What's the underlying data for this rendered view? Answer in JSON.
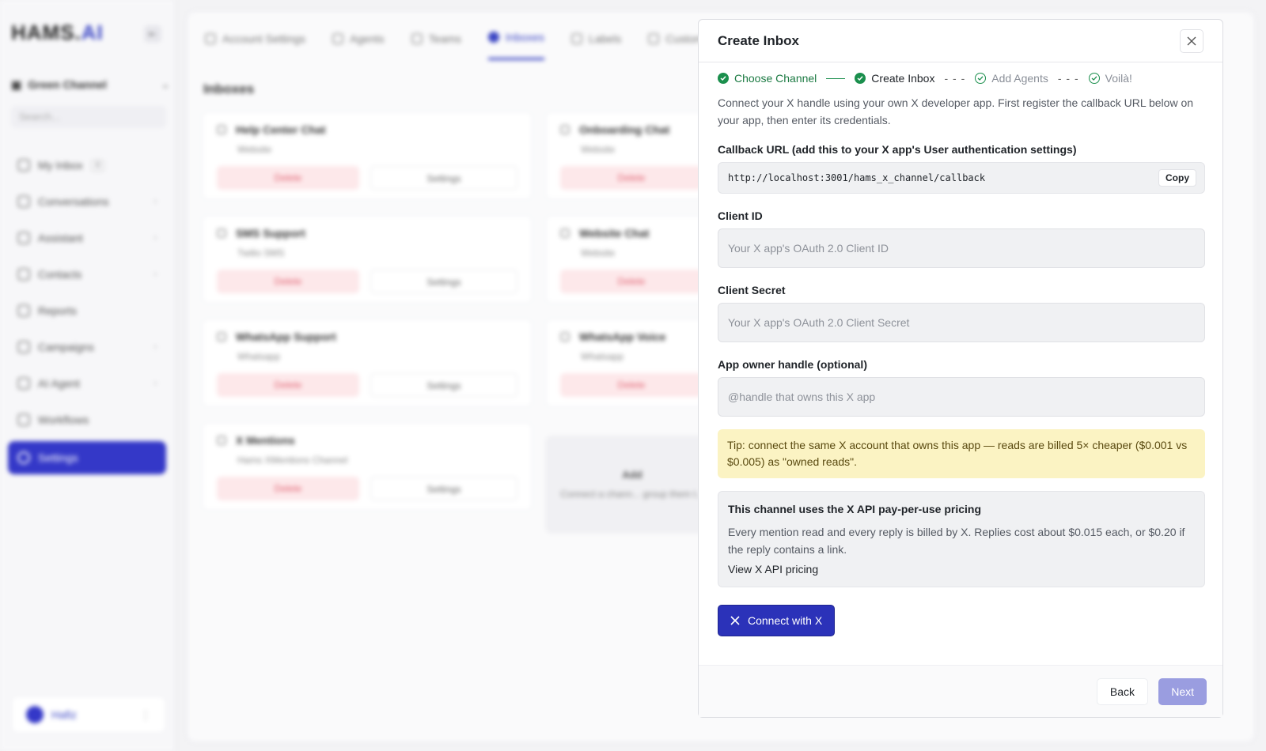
{
  "background": {
    "logo": {
      "text": "HAMS.",
      "accent": "AI"
    },
    "workspace": "Green Channel",
    "search_placeholder": "Search...",
    "nav": [
      {
        "label": "My Inbox",
        "count": "0"
      },
      {
        "label": "Conversations"
      },
      {
        "label": "Assistant"
      },
      {
        "label": "Contacts"
      },
      {
        "label": "Reports"
      },
      {
        "label": "Campaigns"
      },
      {
        "label": "AI Agent"
      },
      {
        "label": "Workflows"
      },
      {
        "label": "Settings"
      }
    ],
    "user_name": "Hafiz",
    "tabs": [
      "Account Settings",
      "Agents",
      "Teams",
      "Inboxes",
      "Labels",
      "Custom Attr"
    ],
    "inboxes_title": "Inboxes",
    "inboxes": [
      {
        "name": "Help Center Chat",
        "type": "Website"
      },
      {
        "name": "Onboarding Chat",
        "type": "Website"
      },
      {
        "name": "SMS Support",
        "type": "Twilio SMS"
      },
      {
        "name": "Website Chat",
        "type": "Website"
      },
      {
        "name": "WhatsApp Support",
        "type": "Whatsapp"
      },
      {
        "name": "WhatsApp Voice",
        "type": "Whatsapp"
      },
      {
        "name": "X Mentions",
        "type": "Hams XMentions Channel"
      }
    ],
    "delete_label": "Delete",
    "settings_label": "Settings",
    "add_card": {
      "title": "Add",
      "text": "Connect a chann... group them t..."
    }
  },
  "modal": {
    "title": "Create Inbox",
    "steps": [
      {
        "label": "Choose Channel",
        "state": "done"
      },
      {
        "label": "Create Inbox",
        "state": "done"
      },
      {
        "label": "Add Agents",
        "state": "pending"
      },
      {
        "label": "Voilà!",
        "state": "pending"
      }
    ],
    "intro": "Connect your X handle using your own X developer app. First register the callback URL below on your app, then enter its credentials.",
    "callback_label": "Callback URL (add this to your X app's User authentication settings)",
    "callback_url": "http://localhost:3001/hams_x_channel/callback",
    "copy_label": "Copy",
    "client_id": {
      "label": "Client ID",
      "placeholder": "Your X app's OAuth 2.0 Client ID",
      "value": ""
    },
    "client_secret": {
      "label": "Client Secret",
      "placeholder": "Your X app's OAuth 2.0 Client Secret",
      "value": ""
    },
    "owner_handle": {
      "label": "App owner handle (optional)",
      "placeholder": "@handle that owns this X app",
      "value": ""
    },
    "tip": "Tip: connect the same X account that owns this app — reads are billed 5× cheaper ($0.001 vs $0.005) as \"owned reads\".",
    "pricing": {
      "title": "This channel uses the X API pay-per-use pricing",
      "text": "Every mention read and every reply is billed by X. Replies cost about $0.015 each, or $0.20 if the reply contains a link.",
      "link": "View X API pricing"
    },
    "connect_label": "Connect with X",
    "back_label": "Back",
    "next_label": "Next"
  },
  "colors": {
    "primary": "#2b32b9",
    "success": "#1b8f4d",
    "tip_bg": "#fbf3c3",
    "next_disabled": "#9a9de0"
  }
}
